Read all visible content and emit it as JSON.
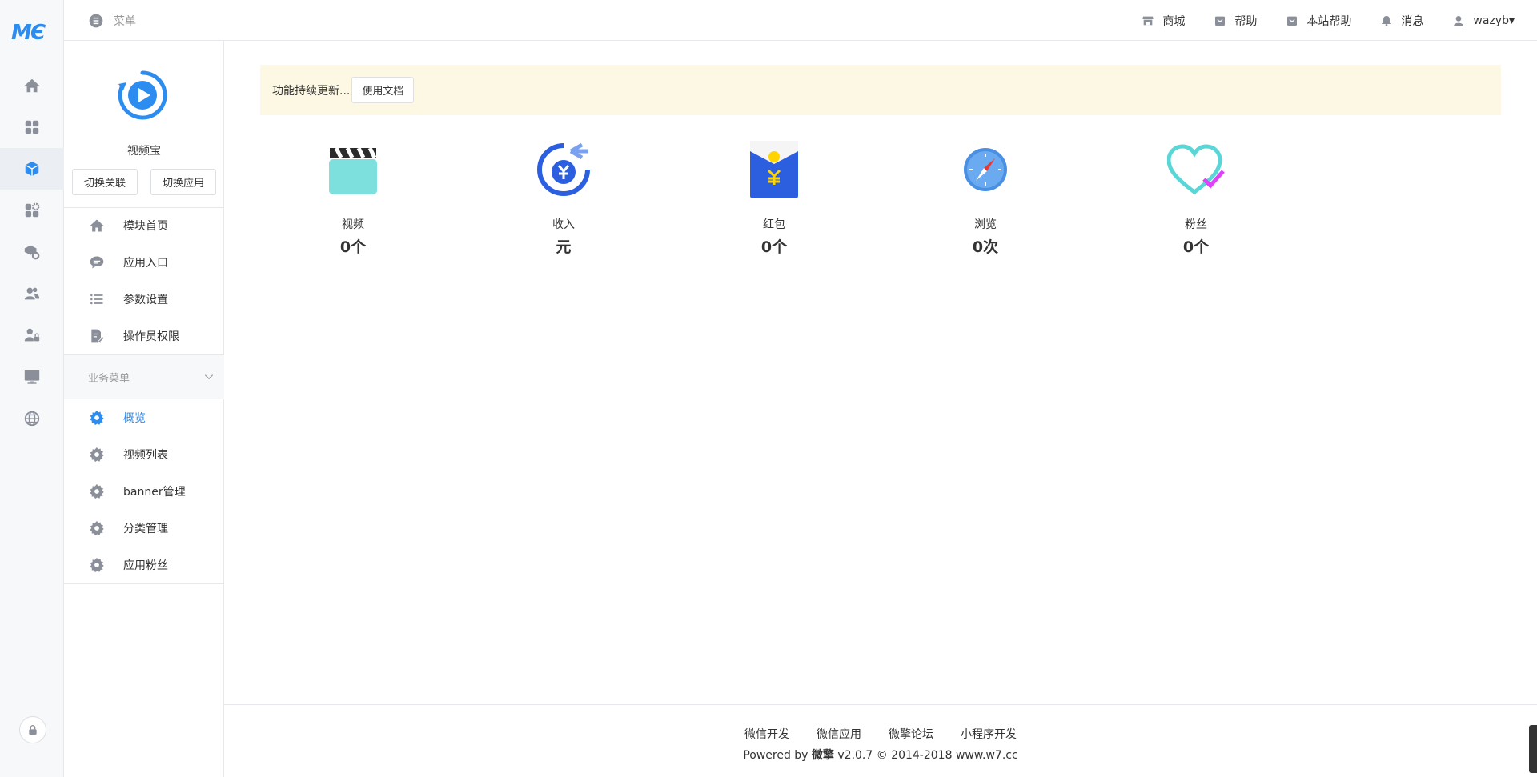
{
  "rail": {
    "logo_text": "MЄ",
    "items": [
      {
        "icon": "home-icon",
        "active": false
      },
      {
        "icon": "apps-grid-icon",
        "active": false
      },
      {
        "icon": "cube-icon",
        "active": true
      },
      {
        "icon": "gear-grid-icon",
        "active": false
      },
      {
        "icon": "package-settings-icon",
        "active": false
      },
      {
        "icon": "users-icon",
        "active": false
      },
      {
        "icon": "user-lock-icon",
        "active": false
      },
      {
        "icon": "monitor-icon",
        "active": false
      },
      {
        "icon": "globe-icon",
        "active": false
      }
    ],
    "bottom_icon": "lock-icon"
  },
  "topbar": {
    "menu_label": "菜单",
    "links": [
      {
        "icon": "store-icon",
        "label": "商城"
      },
      {
        "icon": "help-bag-icon",
        "label": "帮助"
      },
      {
        "icon": "site-help-icon",
        "label": "本站帮助"
      },
      {
        "icon": "bell-icon",
        "label": "消息"
      },
      {
        "icon": "user-icon",
        "label": "wazyb▾"
      }
    ]
  },
  "sidebar": {
    "app_name": "视频宝",
    "switch_link_label": "切换关联",
    "switch_app_label": "切换应用",
    "menu": [
      {
        "icon": "home-icon",
        "label": "模块首页"
      },
      {
        "icon": "chat-icon",
        "label": "应用入口"
      },
      {
        "icon": "list-icon",
        "label": "参数设置"
      },
      {
        "icon": "doc-edit-icon",
        "label": "操作员权限"
      }
    ],
    "section_title": "业务菜单",
    "business_menu": [
      {
        "icon": "gear-icon",
        "label": "概览",
        "active": true
      },
      {
        "icon": "gear-icon",
        "label": "视频列表",
        "active": false
      },
      {
        "icon": "gear-icon",
        "label": "banner管理",
        "active": false
      },
      {
        "icon": "gear-icon",
        "label": "分类管理",
        "active": false
      },
      {
        "icon": "gear-icon",
        "label": "应用粉丝",
        "active": false
      }
    ]
  },
  "notice": {
    "text": "功能持续更新...",
    "doc_button": "使用文档"
  },
  "stats": [
    {
      "icon": "clapperboard-icon",
      "label": "视频",
      "value": "0个"
    },
    {
      "icon": "income-icon",
      "label": "收入",
      "value": "元"
    },
    {
      "icon": "red-packet-icon",
      "label": "红包",
      "value": "0个"
    },
    {
      "icon": "compass-icon",
      "label": "浏览",
      "value": "0次"
    },
    {
      "icon": "heart-check-icon",
      "label": "粉丝",
      "value": "0个"
    }
  ],
  "footer": {
    "links": [
      "微信开发",
      "微信应用",
      "微擎论坛",
      "小程序开发"
    ],
    "powered_prefix": "Powered by ",
    "brand": "微擎",
    "powered_suffix": " v2.0.7 © 2014-2018 www.w7.cc"
  }
}
